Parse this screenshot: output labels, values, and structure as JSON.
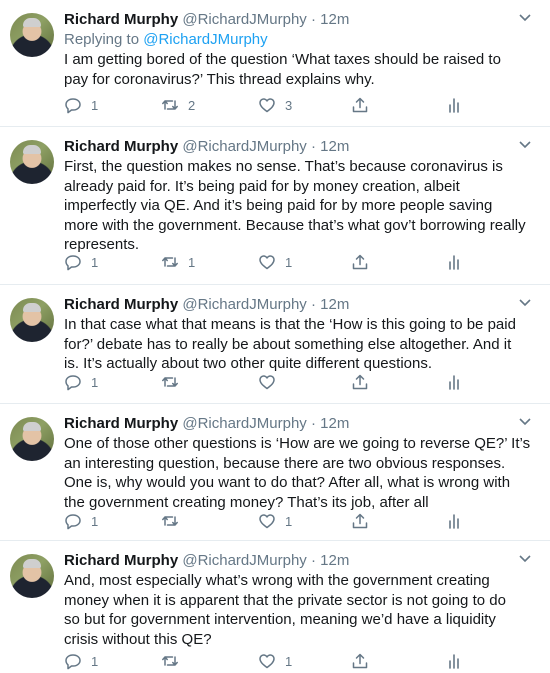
{
  "tweets": [
    {
      "author": "Richard Murphy",
      "handle": "@RichardJMurphy",
      "dot": "·",
      "time": "12m",
      "replying_prefix": "Replying to ",
      "replying_to": "@RichardJMurphy",
      "text": "I am getting bored of the question ‘What taxes should be raised to\npay for coronavirus?’ This thread explains why.",
      "reply_count": "1",
      "retweet_count": "2",
      "like_count": "3"
    },
    {
      "author": "Richard Murphy",
      "handle": "@RichardJMurphy",
      "dot": "·",
      "time": "12m",
      "text": "First, the question makes no sense. That’s  because coronavirus is\nalready paid for. It’s being paid for by money creation, albeit\nimperfectly via QE. And it’s being paid for by more people saving\nmore with the government. Because that’s what gov’t borrowing really\nrepresents.",
      "reply_count": "1",
      "retweet_count": "1",
      "like_count": "1"
    },
    {
      "author": "Richard Murphy",
      "handle": "@RichardJMurphy",
      "dot": "·",
      "time": "12m",
      "text": "In that case what that means is that the ‘How is this going to be paid\nfor?’ debate has to really be about something else altogether. And it\nis. It’s actually about two other quite different questions.",
      "reply_count": "1",
      "retweet_count": "",
      "like_count": ""
    },
    {
      "author": "Richard Murphy",
      "handle": "@RichardJMurphy",
      "dot": "·",
      "time": "12m",
      "text": "One of those other questions is ‘How are we going to reverse QE?’ It’s\nan interesting question, because there are two obvious responses.\nOne is, why would you want to do that? After all, what is wrong with\nthe government creating money? That’s its job, after all",
      "reply_count": "1",
      "retweet_count": "",
      "like_count": "1"
    },
    {
      "author": "Richard Murphy",
      "handle": "@RichardJMurphy",
      "dot": "·",
      "time": "12m",
      "text": "And, most especially what’s wrong with the government creating\nmoney when it is apparent that the private sector is not going to do\nso but for government intervention, meaning we’d have a liquidity\ncrisis without this QE?",
      "reply_count": "1",
      "retweet_count": "",
      "like_count": "1"
    }
  ],
  "colors": {
    "text": "#14171a",
    "muted": "#657786",
    "link": "#1da1f2",
    "divider": "#e6ecf0"
  },
  "icons": {
    "reply": "reply-icon",
    "retweet": "retweet-icon",
    "like": "like-icon",
    "share": "share-icon",
    "analytics": "analytics-icon",
    "menu": "chevron-down-icon"
  }
}
